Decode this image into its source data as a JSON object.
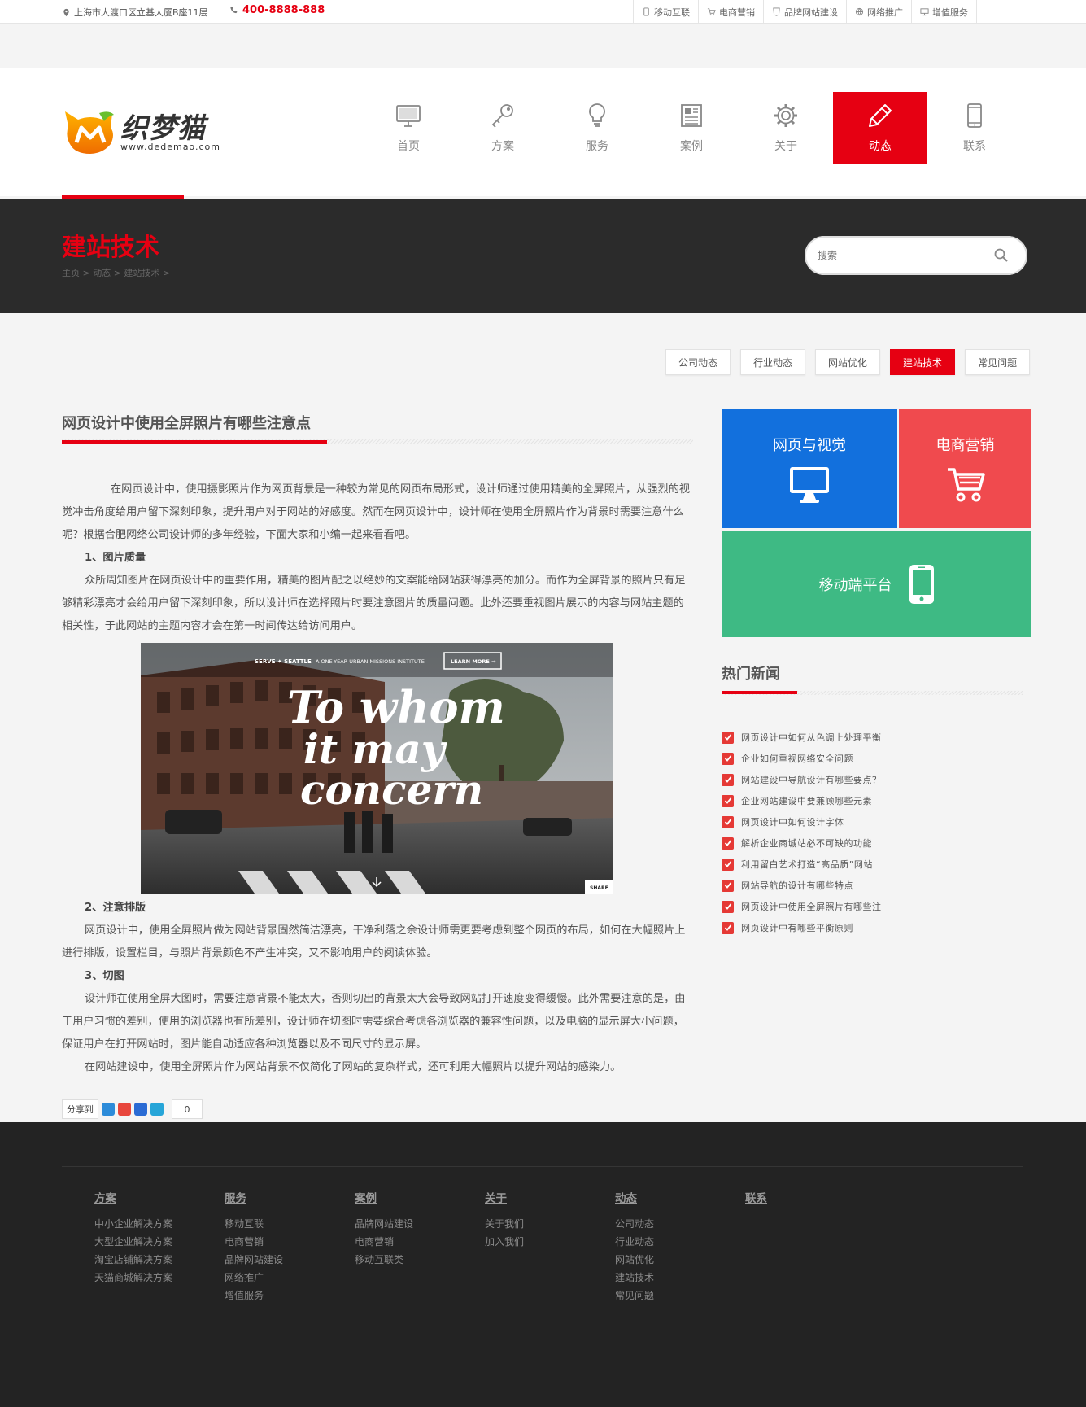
{
  "topbar": {
    "address": "上海市大渡口区立基大厦B座11层",
    "phone": "400-8888-888",
    "links": [
      "移动互联",
      "电商营销",
      "品牌网站建设",
      "网络推广",
      "增值服务"
    ]
  },
  "logo": {
    "cn": "织梦猫",
    "en": "www.dedemao.com"
  },
  "nav": [
    {
      "label": "首页",
      "icon": "monitor-icon"
    },
    {
      "label": "方案",
      "icon": "key-icon"
    },
    {
      "label": "服务",
      "icon": "lightbulb-icon"
    },
    {
      "label": "案例",
      "icon": "newspaper-icon"
    },
    {
      "label": "关于",
      "icon": "gear-icon"
    },
    {
      "label": "动态",
      "icon": "pencil-icon",
      "active": true
    },
    {
      "label": "联系",
      "icon": "phone-icon"
    }
  ],
  "page": {
    "title": "建站技术",
    "breadcrumb": "主页 > 动态 > 建站技术 >",
    "search_placeholder": "搜索"
  },
  "tabs": [
    {
      "label": "公司动态"
    },
    {
      "label": "行业动态"
    },
    {
      "label": "网站优化"
    },
    {
      "label": "建站技术",
      "active": true
    },
    {
      "label": "常见问题"
    }
  ],
  "article": {
    "title": "网页设计中使用全屏照片有哪些注意点",
    "p1": "在网页设计中，使用摄影照片作为网页背景是一种较为常见的网页布局形式，设计师通过使用精美的全屏照片，从强烈的视觉冲击角度给用户留下深刻印象，提升用户对于网站的好感度。然而在网页设计中，设计师在使用全屏照片作为背景时需要注意什么呢？根据合肥网络公司设计师的多年经验，下面大家和小编一起来看看吧。",
    "h1": "1、图片质量",
    "p2": "众所周知图片在网页设计中的重要作用，精美的图片配之以绝妙的文案能给网站获得漂亮的加分。而作为全屏背景的照片只有足够精彩漂亮才会给用户留下深刻印象，所以设计师在选择照片时要注意图片的质量问题。此外还要重视图片展示的内容与网站主题的相关性，于此网站的主题内容才会在第一时间传达给访问用户。",
    "photo": {
      "brand": "SERVE ✦ SEATTLE",
      "tagline": "A ONE-YEAR URBAN MISSIONS INSTITUTE",
      "button": "LEARN MORE →",
      "headline_1": "To whom",
      "headline_2": "it may",
      "headline_3": "concern",
      "share": "SHARE"
    },
    "h2": "2、注意排版",
    "p3": "网页设计中，使用全屏照片做为网站背景固然简洁漂亮，干净利落之余设计师需更要考虑到整个网页的布局，如何在大幅照片上进行排版，设置栏目，与照片背景颜色不产生冲突，又不影响用户的阅读体验。",
    "h3": "3、切图",
    "p4": "设计师在使用全屏大图时，需要注意背景不能太大，否则切出的背景太大会导致网站打开速度变得缓慢。此外需要注意的是，由于用户习惯的差别，使用的浏览器也有所差别，设计师在切图时需要综合考虑各浏览器的兼容性问题，以及电脑的显示屏大小问题，保证用户在打开网站时，图片能自动适应各种浏览器以及不同尺寸的显示屏。",
    "p5": "在网站建设中，使用全屏照片作为网站背景不仅简化了网站的复杂样式，还可利用大幅照片以提升网站的感染力。",
    "share_label": "分享到",
    "share_count": "0"
  },
  "tiles": {
    "web": "网页与视觉",
    "ecom": "电商营销",
    "mobile": "移动端平台"
  },
  "hot": {
    "title": "热门新闻",
    "items": [
      "网页设计中如何从色调上处理平衡",
      "企业如何重视网络安全问题",
      "网站建设中导航设计有哪些要点？",
      "企业网站建设中要兼顾哪些元素",
      "网页设计中如何设计字体",
      "解析企业商城站必不可缺的功能",
      "利用留白艺术打造“高品质”网站",
      "网站导航的设计有哪些特点",
      "网页设计中使用全屏照片有哪些注",
      "网页设计中有哪些平衡原则"
    ]
  },
  "footer": {
    "cols": [
      {
        "title": "方案",
        "items": [
          "中小企业解决方案",
          "大型企业解决方案",
          "淘宝店铺解决方案",
          "天猫商城解决方案"
        ]
      },
      {
        "title": "服务",
        "items": [
          "移动互联",
          "电商营销",
          "品牌网站建设",
          "网络推广",
          "增值服务"
        ]
      },
      {
        "title": "案例",
        "items": [
          "品牌网站建设",
          "电商营销",
          "移动互联类"
        ]
      },
      {
        "title": "关于",
        "items": [
          "关于我们",
          "加入我们"
        ]
      },
      {
        "title": "动态",
        "items": [
          "公司动态",
          "行业动态",
          "网站优化",
          "建站技术",
          "常见问题"
        ]
      },
      {
        "title": "联系",
        "items": []
      }
    ]
  },
  "colors": {
    "accent": "#e60012",
    "blue": "#1270dd",
    "coral": "#f04a4e",
    "green": "#3eba84",
    "dark": "#2b2b2b"
  }
}
